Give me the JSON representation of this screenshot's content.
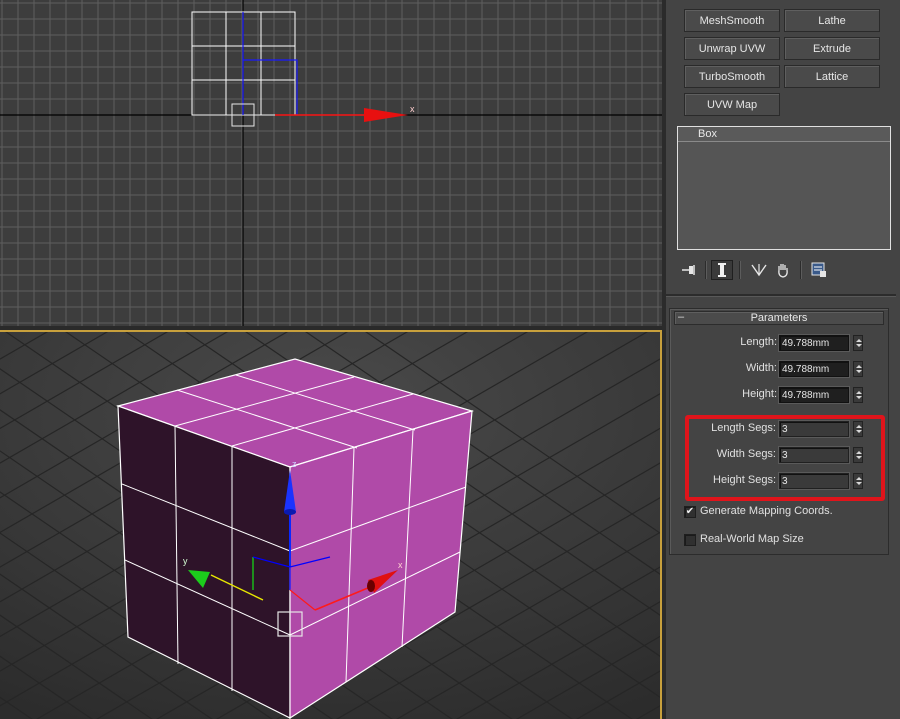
{
  "viewports": {
    "top": {
      "axis_labels": {
        "x": "x"
      }
    },
    "perspective": {
      "gizmo_labels": {
        "z": "z",
        "y": "y",
        "x": "x"
      }
    }
  },
  "modifier_buttons": [
    {
      "label": "MeshSmooth"
    },
    {
      "label": "Lathe"
    },
    {
      "label": "Unwrap UVW"
    },
    {
      "label": "Extrude"
    },
    {
      "label": "TurboSmooth"
    },
    {
      "label": "Lattice"
    },
    {
      "label": "UVW Map"
    }
  ],
  "modifier_stack": {
    "items": [
      "Box"
    ]
  },
  "stack_toolbar": {
    "icons": [
      "pin-stack-icon",
      "show-end-result-icon",
      "make-unique-icon",
      "remove-modifier-icon",
      "configure-modifier-sets-icon"
    ]
  },
  "parameters": {
    "title": "Parameters",
    "collapse_symbol": "–",
    "length": {
      "label": "Length:",
      "value": "49.788mm"
    },
    "width": {
      "label": "Width:",
      "value": "49.788mm"
    },
    "height": {
      "label": "Height:",
      "value": "49.788mm"
    },
    "length_segs": {
      "label": "Length Segs:",
      "value": "3"
    },
    "width_segs": {
      "label": "Width Segs:",
      "value": "3"
    },
    "height_segs": {
      "label": "Height Segs:",
      "value": "3"
    },
    "generate_mapping": {
      "label": "Generate Mapping Coords.",
      "checked": true,
      "mark": "✔"
    },
    "real_world": {
      "label": "Real-World Map Size",
      "checked": false
    }
  },
  "colors": {
    "highlight": "#e0141b",
    "box_face": "#b04aa8",
    "viewport_active_border": "#c8a03c"
  }
}
